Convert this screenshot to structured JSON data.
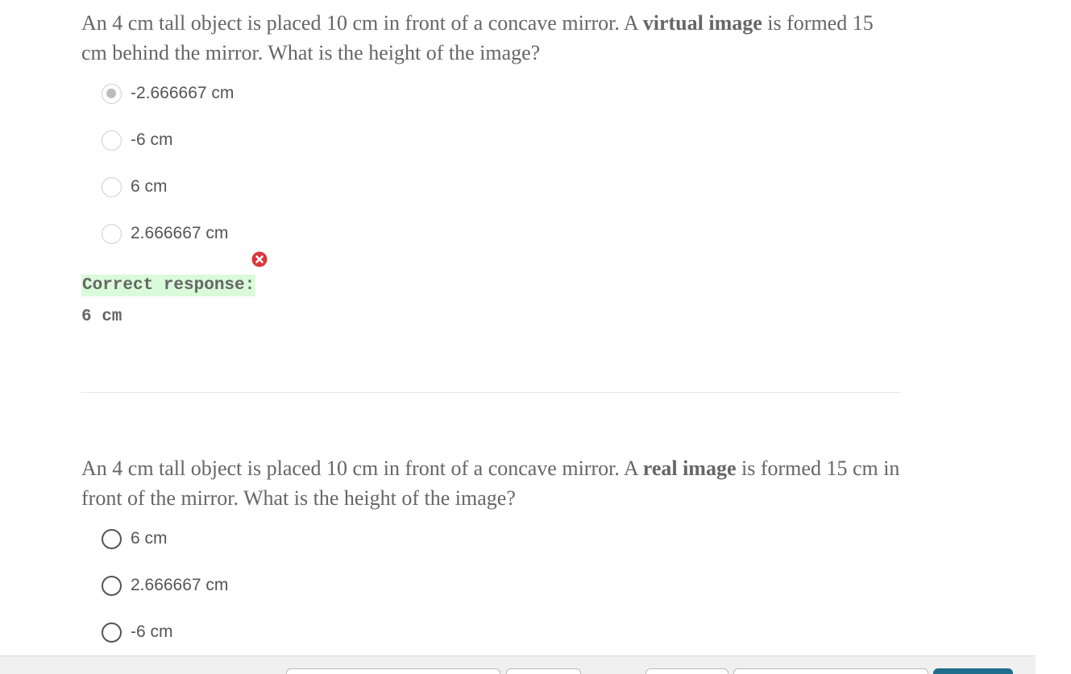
{
  "question1": {
    "prompt_before": "An 4 cm tall object is placed 10 cm in front of a concave mirror. A ",
    "prompt_emphasis": "virtual image",
    "prompt_after": " is formed 15 cm behind the mirror. What is the height of the image?",
    "options": [
      {
        "label": "-2.666667 cm",
        "selected": true
      },
      {
        "label": "-6 cm",
        "selected": false
      },
      {
        "label": "6 cm",
        "selected": false
      },
      {
        "label": "2.666667 cm",
        "selected": false
      }
    ],
    "result_icon": "x-circle-icon",
    "correct_label": "Correct response:",
    "correct_value": "6 cm"
  },
  "question2": {
    "prompt_before": "An 4 cm tall object is placed 10 cm in front of a concave mirror. A ",
    "prompt_emphasis": "real image",
    "prompt_after": " is formed 15 cm in front of the mirror. What is the height of the image?",
    "options": [
      {
        "label": "6 cm",
        "selected": false
      },
      {
        "label": "2.666667 cm",
        "selected": false
      },
      {
        "label": "-6 cm",
        "selected": false
      }
    ]
  },
  "colors": {
    "correct_highlight": "#d9fbd9",
    "error_red": "#d9363e",
    "primary_button": "#1e6e8c"
  }
}
